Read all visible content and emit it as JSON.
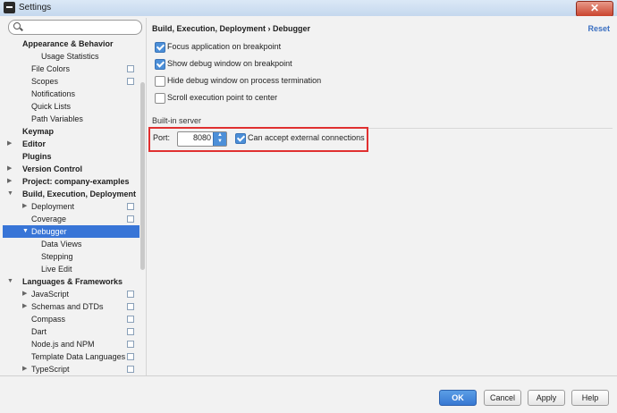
{
  "window": {
    "title": "Settings",
    "close_label": "✕"
  },
  "sidebar": {
    "search_placeholder": "",
    "items": [
      {
        "label": "Appearance & Behavior",
        "level": 1,
        "bold": true,
        "arrow": "none",
        "copy": false
      },
      {
        "label": "Usage Statistics",
        "level": 3,
        "bold": false,
        "arrow": "none",
        "copy": false
      },
      {
        "label": "File Colors",
        "level": 2,
        "bold": false,
        "arrow": "none",
        "copy": true
      },
      {
        "label": "Scopes",
        "level": 2,
        "bold": false,
        "arrow": "none",
        "copy": true
      },
      {
        "label": "Notifications",
        "level": 2,
        "bold": false,
        "arrow": "none",
        "copy": false
      },
      {
        "label": "Quick Lists",
        "level": 2,
        "bold": false,
        "arrow": "none",
        "copy": false
      },
      {
        "label": "Path Variables",
        "level": 2,
        "bold": false,
        "arrow": "none",
        "copy": false
      },
      {
        "label": "Keymap",
        "level": 1,
        "bold": true,
        "arrow": "none",
        "copy": false
      },
      {
        "label": "Editor",
        "level": 1,
        "bold": true,
        "arrow": "right",
        "copy": false
      },
      {
        "label": "Plugins",
        "level": 1,
        "bold": true,
        "arrow": "none",
        "copy": false
      },
      {
        "label": "Version Control",
        "level": 1,
        "bold": true,
        "arrow": "right",
        "copy": false
      },
      {
        "label": "Project: company-examples",
        "level": 1,
        "bold": true,
        "arrow": "right",
        "copy": false
      },
      {
        "label": "Build, Execution, Deployment",
        "level": 1,
        "bold": true,
        "arrow": "down",
        "copy": false
      },
      {
        "label": "Deployment",
        "level": 2,
        "bold": false,
        "arrow": "right",
        "copy": true
      },
      {
        "label": "Coverage",
        "level": 2,
        "bold": false,
        "arrow": "none",
        "copy": true
      },
      {
        "label": "Debugger",
        "level": 2,
        "bold": false,
        "arrow": "down",
        "copy": false,
        "selected": true
      },
      {
        "label": "Data Views",
        "level": 3,
        "bold": false,
        "arrow": "none",
        "copy": false
      },
      {
        "label": "Stepping",
        "level": 3,
        "bold": false,
        "arrow": "none",
        "copy": false
      },
      {
        "label": "Live Edit",
        "level": 3,
        "bold": false,
        "arrow": "none",
        "copy": false
      },
      {
        "label": "Languages & Frameworks",
        "level": 1,
        "bold": true,
        "arrow": "down",
        "copy": false
      },
      {
        "label": "JavaScript",
        "level": 2,
        "bold": false,
        "arrow": "right",
        "copy": true
      },
      {
        "label": "Schemas and DTDs",
        "level": 2,
        "bold": false,
        "arrow": "right",
        "copy": true
      },
      {
        "label": "Compass",
        "level": 2,
        "bold": false,
        "arrow": "none",
        "copy": true
      },
      {
        "label": "Dart",
        "level": 2,
        "bold": false,
        "arrow": "none",
        "copy": true
      },
      {
        "label": "Node.js and NPM",
        "level": 2,
        "bold": false,
        "arrow": "none",
        "copy": true
      },
      {
        "label": "Template Data Languages",
        "level": 2,
        "bold": false,
        "arrow": "none",
        "copy": true
      },
      {
        "label": "TypeScript",
        "level": 2,
        "bold": false,
        "arrow": "right",
        "copy": true
      }
    ]
  },
  "main": {
    "breadcrumb": "Build, Execution, Deployment › Debugger",
    "reset_label": "Reset",
    "options": [
      {
        "label": "Focus application on breakpoint",
        "checked": true
      },
      {
        "label": "Show debug window on breakpoint",
        "checked": true
      },
      {
        "label": "Hide debug window on process termination",
        "checked": false
      },
      {
        "label": "Scroll execution point to center",
        "checked": false
      }
    ],
    "server_section": "Built-in server",
    "port_label": "Port:",
    "port_value": "8080",
    "external_label": "Can accept external connections",
    "external_checked": true
  },
  "buttons": {
    "ok": "OK",
    "cancel": "Cancel",
    "apply": "Apply",
    "help": "Help"
  },
  "colors": {
    "selection": "#3875d7",
    "highlight": "#e03030",
    "link": "#3a6fc1"
  }
}
